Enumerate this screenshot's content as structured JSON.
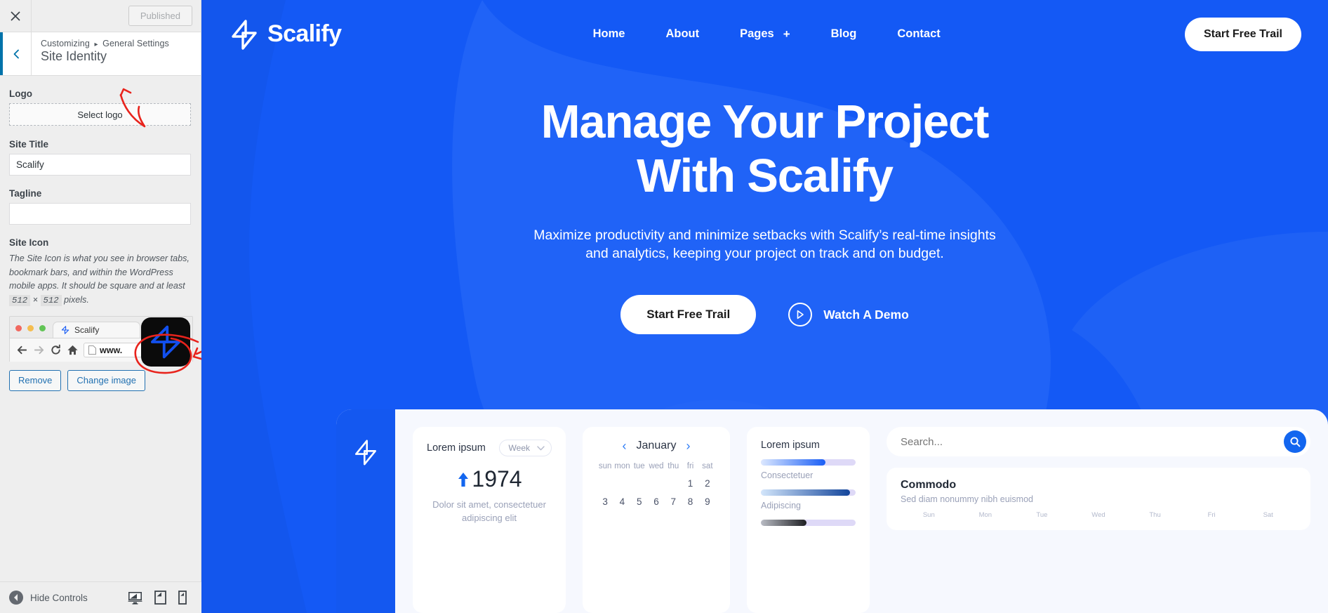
{
  "customizer": {
    "close_icon": "close-icon",
    "publish_label": "Published",
    "back_icon": "chevron-left-icon",
    "breadcrumb_root": "Customizing",
    "breadcrumb_sep": "▸",
    "breadcrumb_section": "General Settings",
    "panel_title": "Site Identity",
    "logo": {
      "label": "Logo",
      "select_label": "Select logo"
    },
    "site_title": {
      "label": "Site Title",
      "value": "Scalify",
      "placeholder": ""
    },
    "tagline": {
      "label": "Tagline",
      "value": "",
      "placeholder": ""
    },
    "site_icon": {
      "label": "Site Icon",
      "desc_a": "The Site Icon is what you see in browser tabs, bookmark bars, and within the WordPress mobile apps. It should be square and at least",
      "dim_a": "512",
      "desc_b": "×",
      "dim_b": "512",
      "desc_c": "pixels.",
      "remove_label": "Remove",
      "change_label": "Change image"
    },
    "browser_preview": {
      "tab_title": "Scalify",
      "url_text": "www.",
      "back_icon": "arrow-left-icon",
      "forward_icon": "arrow-right-icon",
      "reload_icon": "reload-icon",
      "home_icon": "home-icon",
      "page_icon": "page-icon"
    },
    "footer": {
      "hide_controls_label": "Hide Controls",
      "collapse_icon": "collapse-left-icon",
      "devices": [
        {
          "name": "device-desktop-icon"
        },
        {
          "name": "device-tablet-icon"
        },
        {
          "name": "device-mobile-icon"
        }
      ]
    }
  },
  "site": {
    "brand": "Scalify",
    "nav": [
      {
        "label": "Home",
        "plus": ""
      },
      {
        "label": "About",
        "plus": ""
      },
      {
        "label": "Pages",
        "plus": "+"
      },
      {
        "label": "Blog",
        "plus": ""
      },
      {
        "label": "Contact",
        "plus": ""
      }
    ],
    "nav_cta": "Start Free Trail",
    "hero": {
      "title_line1": "Manage Your Project",
      "title_line2": "With Scalify",
      "subtitle": "Maximize productivity and minimize setbacks with Scalify’s real-time insights and analytics, keeping your project on track and on budget.",
      "primary_cta": "Start Free Trail",
      "secondary_cta": "Watch A Demo"
    },
    "dashboard": {
      "stat_card": {
        "title": "Lorem ipsum",
        "range_label": "Week",
        "trend_icon": "arrow-up-icon",
        "value": "1974",
        "caption": "Dolor sit amet, consectetuer adipiscing elit"
      },
      "calendar": {
        "month": "January",
        "prev_icon": "chevron-left-icon",
        "next_icon": "chevron-right-icon",
        "dow": [
          "sun",
          "mon",
          "tue",
          "wed",
          "thu",
          "fri",
          "sat"
        ],
        "weeks": [
          [
            "",
            "",
            "",
            "",
            "",
            "1",
            "2"
          ],
          [
            "3",
            "4",
            "5",
            "6",
            "7",
            "8",
            "9"
          ]
        ]
      },
      "bars_card": {
        "title": "Lorem ipsum",
        "bars": [
          {
            "label": "Consectetuer",
            "pct": 68,
            "color_from": "#dce8ff",
            "color_to": "#1a5ef5"
          },
          {
            "label": "Adipiscing",
            "pct": 94,
            "color_from": "#d3e6fb",
            "color_to": "#13459b"
          },
          {
            "label": "",
            "pct": 48,
            "color_from": "#b9bcc4",
            "color_to": "#1e1f23"
          }
        ]
      },
      "search": {
        "placeholder": "Search...",
        "icon": "search-icon"
      },
      "commodo": {
        "title": "Commodo",
        "subtitle": "Sed diam nonummy nibh euismod",
        "dow": [
          "Sun",
          "Mon",
          "Tue",
          "Wed",
          "Thu",
          "Fri",
          "Sat"
        ]
      }
    }
  },
  "colors": {
    "brand_blue": "#1459f5",
    "accent_blue": "#1366ef",
    "wp_link": "#2271b1",
    "annotation_red": "#e8231c"
  }
}
